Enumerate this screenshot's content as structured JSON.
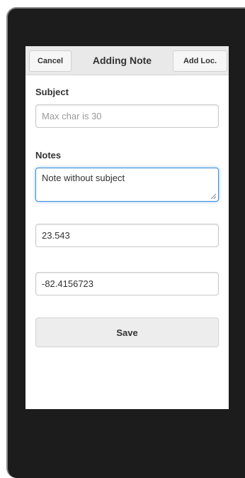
{
  "header": {
    "cancel_label": "Cancel",
    "title": "Adding Note",
    "add_location_label": "Add Loc."
  },
  "form": {
    "subject_label": "Subject",
    "subject_value": "",
    "subject_placeholder": "Max char is 30",
    "notes_label": "Notes",
    "notes_value": "Note without subject",
    "latitude_value": "23.543",
    "longitude_value": "-82.4156723",
    "save_label": "Save"
  },
  "colors": {
    "focus_border": "#3a8dde",
    "header_bg": "#e9e9e9",
    "device_frame": "#1c1c1c"
  }
}
